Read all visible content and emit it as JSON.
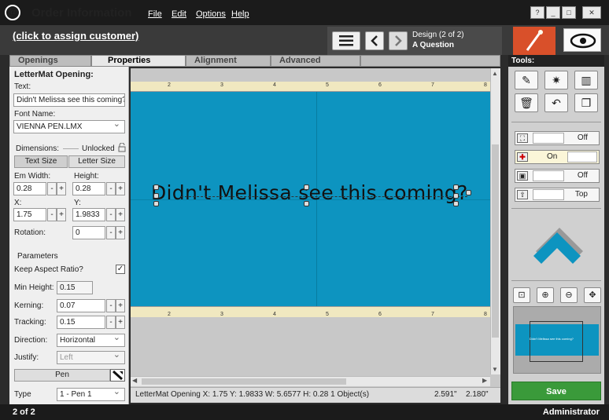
{
  "window": {
    "logo_glyph": "@",
    "title": "Order Information",
    "menu": [
      "File",
      "Edit",
      "Options",
      "Help"
    ],
    "win_buttons": [
      "?",
      "_",
      "□",
      "✕"
    ]
  },
  "customer": {
    "link": "(click to assign customer)"
  },
  "design_nav": {
    "design_label": "Design  (2 of 2)",
    "design_name": "A Question"
  },
  "tabs": [
    "Openings",
    "Properties",
    "Alignment",
    "Advanced"
  ],
  "properties": {
    "heading": "LetterMat Opening:",
    "text_label": "Text:",
    "text_value": "Didn't Melissa see this coming?",
    "font_label": "Font Name:",
    "font_value": "VIENNA PEN.LMX",
    "dimensions_label": "Dimensions:",
    "dimensions_state": "Unlocked",
    "text_size_btn": "Text Size",
    "letter_size_btn": "Letter Size",
    "em_width_label": "Em Width:",
    "em_width_value": "0.28",
    "height_label": "Height:",
    "height_value": "0.28",
    "x_label": "X:",
    "x_value": "1.75",
    "y_label": "Y:",
    "y_value": "1.9833",
    "rotation_label": "Rotation:",
    "rotation_value": "0",
    "parameters_label": "Parameters",
    "keep_aspect_label": "Keep Aspect Ratio?",
    "keep_aspect_checked": true,
    "min_height_label": "Min Height:",
    "min_height_value": "0.15",
    "kerning_label": "Kerning:",
    "kerning_value": "0.07",
    "tracking_label": "Tracking:",
    "tracking_value": "0.15",
    "direction_label": "Direction:",
    "direction_value": "Horizontal",
    "justify_label": "Justify:",
    "justify_value": "Left",
    "pen_btn": "Pen",
    "type_label": "Type",
    "type_value": "1 - Pen 1",
    "minus": "-",
    "plus": "+"
  },
  "canvas": {
    "design_text": "Didn't Melissa see this coming?",
    "ruler_numbers": [
      "2",
      "3",
      "4",
      "5",
      "6",
      "7",
      "8"
    ],
    "colors": {
      "mat": "#0d94c0",
      "ruler": "#f0e8c0"
    }
  },
  "status": {
    "text": "LetterMat Opening  X: 1.75  Y: 1.9833  W: 5.6577  H: 0.28  1 Object(s)",
    "coord_x": "2.591\"",
    "coord_y": "2.180\""
  },
  "tools": {
    "header": "Tools:",
    "toggles": [
      {
        "name": "corner",
        "value": "Off"
      },
      {
        "name": "crosshair",
        "value": "On"
      },
      {
        "name": "square",
        "value": "Off"
      },
      {
        "name": "up",
        "value": "Top"
      }
    ],
    "save": "Save"
  },
  "preview": {
    "text": "Didn't Melissa see this coming?"
  },
  "bottom": {
    "page": "2 of 2",
    "user": "Administrator"
  }
}
